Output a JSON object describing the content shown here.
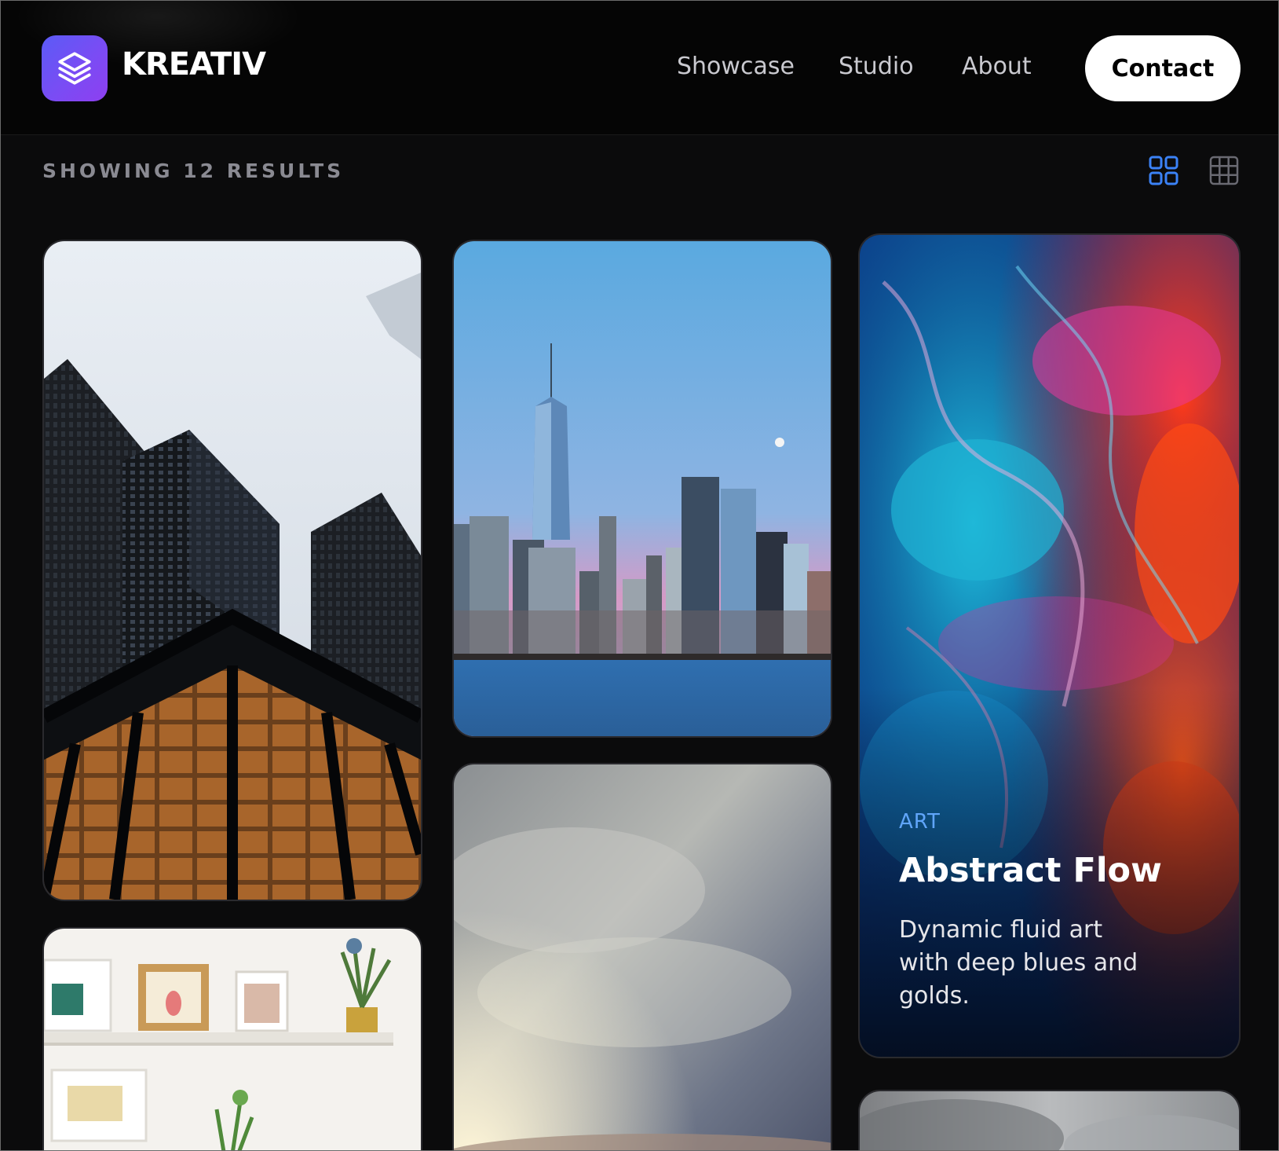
{
  "brand": {
    "name": "KREATIV",
    "logo_icon": "layers-icon",
    "accent": "#6d4ff5"
  },
  "nav": {
    "items": [
      "Showcase",
      "Studio",
      "About"
    ],
    "contact_label": "Contact"
  },
  "toolbar": {
    "results_text": "SHOWING 12 RESULTS",
    "active_view": "grid-large",
    "active_color": "#3b82f6"
  },
  "cards": [
    {
      "image": "glass skyscrapers looking up"
    },
    {
      "image": "city skyline at dusk over water"
    },
    {
      "image": "abstract fluid art",
      "tag": "ART",
      "title": "Abstract Flow",
      "description": "Dynamic fluid art with deep blues and golds."
    },
    {
      "image": "white shelves with framed prints and plants"
    },
    {
      "image": "cloudy sky over desert"
    },
    {
      "image": "grey cloudy sky"
    }
  ]
}
